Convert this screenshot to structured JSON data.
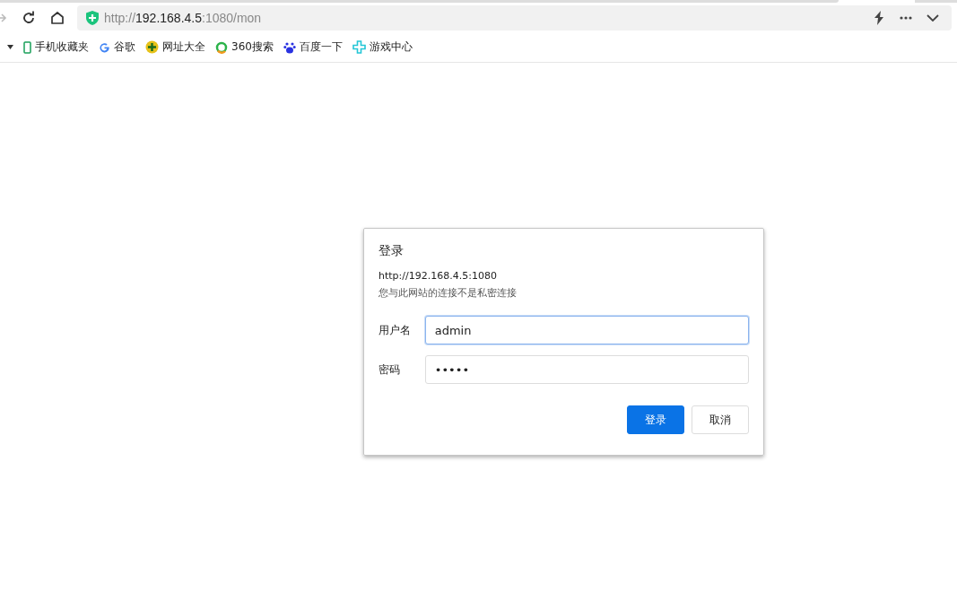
{
  "toolbar": {
    "address": {
      "scheme": "http://",
      "host": "192.168.4.5",
      "rest": ":1080/mon"
    }
  },
  "bookmarks": [
    {
      "kind": "menu"
    },
    {
      "kind": "phone",
      "label": "手机收藏夹"
    },
    {
      "kind": "g",
      "label": "谷歌"
    },
    {
      "kind": "plus",
      "label": "网址大全"
    },
    {
      "kind": "ring",
      "label": "360搜索"
    },
    {
      "kind": "paw",
      "label": "百度一下"
    },
    {
      "kind": "cross",
      "label": "游戏中心"
    }
  ],
  "dialog": {
    "title": "登录",
    "origin": "http://192.168.4.5:1080",
    "warning": "您与此网站的连接不是私密连接",
    "fields": [
      {
        "label": "用户名",
        "value": "admin",
        "focused": true
      },
      {
        "label": "密码",
        "value": "•••••",
        "focused": false
      }
    ],
    "buttons": [
      {
        "label": "登录",
        "primary": true
      },
      {
        "label": "取消",
        "primary": false
      }
    ]
  }
}
